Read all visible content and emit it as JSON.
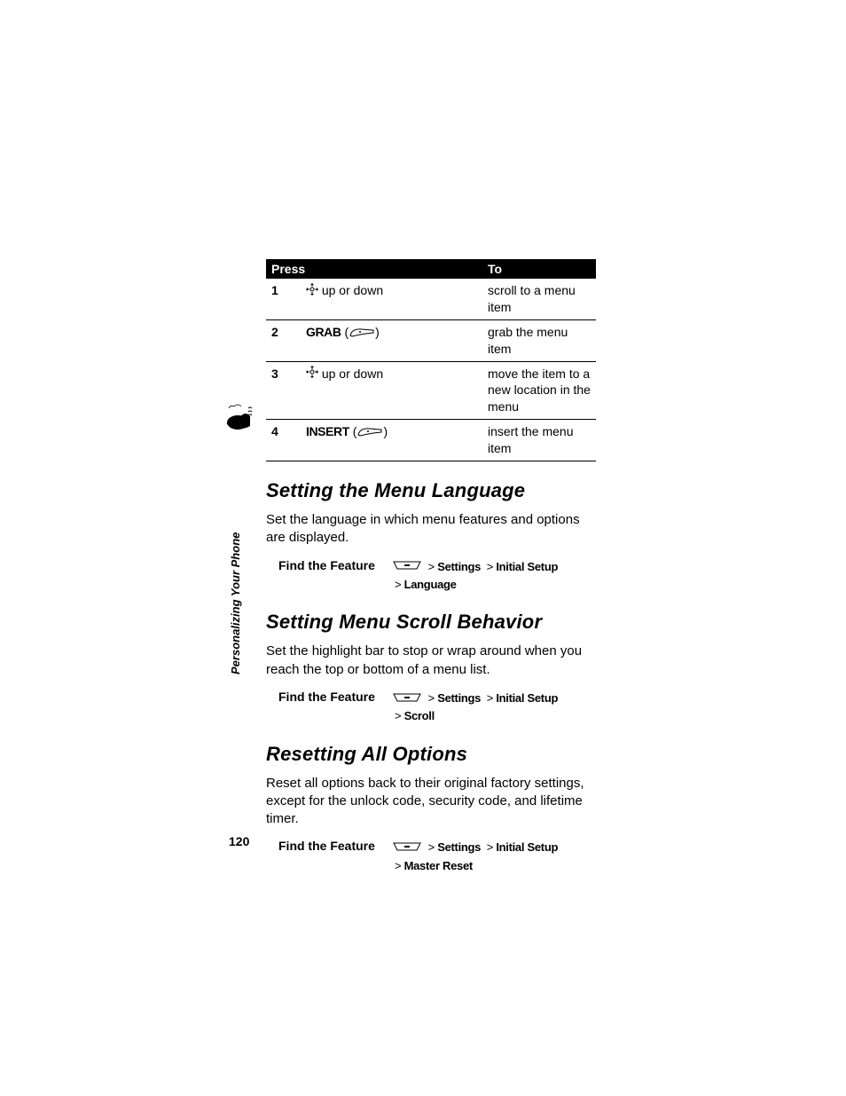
{
  "table": {
    "head_press": "Press",
    "head_to": "To",
    "rows": [
      {
        "n": "1",
        "press_prefix": "",
        "press_label": "up or down",
        "to": "scroll to a menu item",
        "icon": "nav"
      },
      {
        "n": "2",
        "press_bold": "GRAB",
        "to": "grab the menu item",
        "icon": "softkey"
      },
      {
        "n": "3",
        "press_prefix": "",
        "press_label": "up or down",
        "to": "move the item to a new location in the menu",
        "icon": "nav"
      },
      {
        "n": "4",
        "press_bold": "INSERT",
        "to": "insert the menu item",
        "icon": "softkey"
      }
    ]
  },
  "sections": [
    {
      "title": "Setting the Menu Language",
      "body": "Set the language in which menu features and options are displayed.",
      "find_label": "Find the Feature",
      "path_line1": [
        "Settings",
        "Initial Setup"
      ],
      "path_line2": [
        "Language"
      ]
    },
    {
      "title": "Setting Menu Scroll Behavior",
      "body": "Set the highlight bar to stop or wrap around when you reach the top or bottom of a menu list.",
      "find_label": "Find the Feature",
      "path_line1": [
        "Settings",
        "Initial Setup"
      ],
      "path_line2": [
        "Scroll"
      ]
    },
    {
      "title": "Resetting All Options",
      "body": "Reset all options back to their original factory settings, except for the unlock code, security code, and lifetime timer.",
      "find_label": "Find the Feature",
      "path_line1": [
        "Settings",
        "Initial Setup"
      ],
      "path_line2": [
        "Master Reset"
      ]
    }
  ],
  "side_label": "Personalizing Your Phone",
  "page_number": "120"
}
